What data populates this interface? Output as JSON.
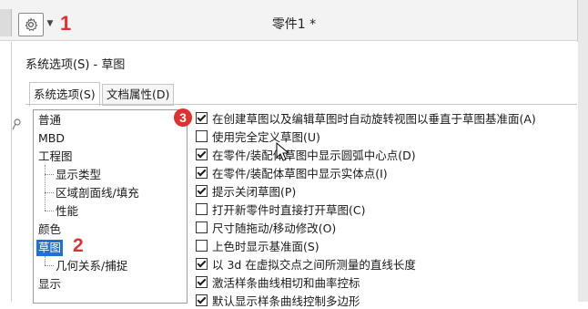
{
  "app": {
    "title": "零件1 *",
    "marker_1": "1"
  },
  "dialog": {
    "title": "系统选项(S) - 草图",
    "tabs": [
      {
        "label": "系统选项(S)",
        "active": true
      },
      {
        "label": "文档属性(D)",
        "active": false
      }
    ]
  },
  "tree": {
    "items": [
      {
        "label": "普通"
      },
      {
        "label": "MBD"
      },
      {
        "label": "工程图"
      },
      {
        "label": "显示类型"
      },
      {
        "label": "区域剖面线/填充"
      },
      {
        "label": "性能"
      },
      {
        "label": "颜色"
      },
      {
        "label": "草图",
        "selected": true
      },
      {
        "label": "几何关系/捕捉"
      },
      {
        "label": "显示"
      }
    ],
    "marker_2": "2"
  },
  "options": {
    "marker_3": "3",
    "items": [
      {
        "label": "在创建草图以及编辑草图时自动旋转视图以垂直于草图基准面(A)",
        "checked": true
      },
      {
        "label": "使用完全定义草图(U)",
        "checked": false
      },
      {
        "label": "在零件/装配体草图中显示圆弧中心点(D)",
        "checked": true
      },
      {
        "label": "在零件/装配体草图中显示实体点(I)",
        "checked": true
      },
      {
        "label": "提示关闭草图(P)",
        "checked": true
      },
      {
        "label": "打开新零件时直接打开草图(C)",
        "checked": false
      },
      {
        "label": "尺寸随拖动/移动修改(O)",
        "checked": false
      },
      {
        "label": "上色时显示基准面(S)",
        "checked": false
      },
      {
        "label": "以 3d 在虚拟交点之间所测量的直线长度",
        "checked": true
      },
      {
        "label": "激活样条曲线相切和曲率控标",
        "checked": true
      },
      {
        "label": "默认显示样条曲线控制多边形",
        "checked": true
      }
    ]
  },
  "colors": {
    "marker": "#e03030",
    "selection": "#1e6fd9"
  }
}
